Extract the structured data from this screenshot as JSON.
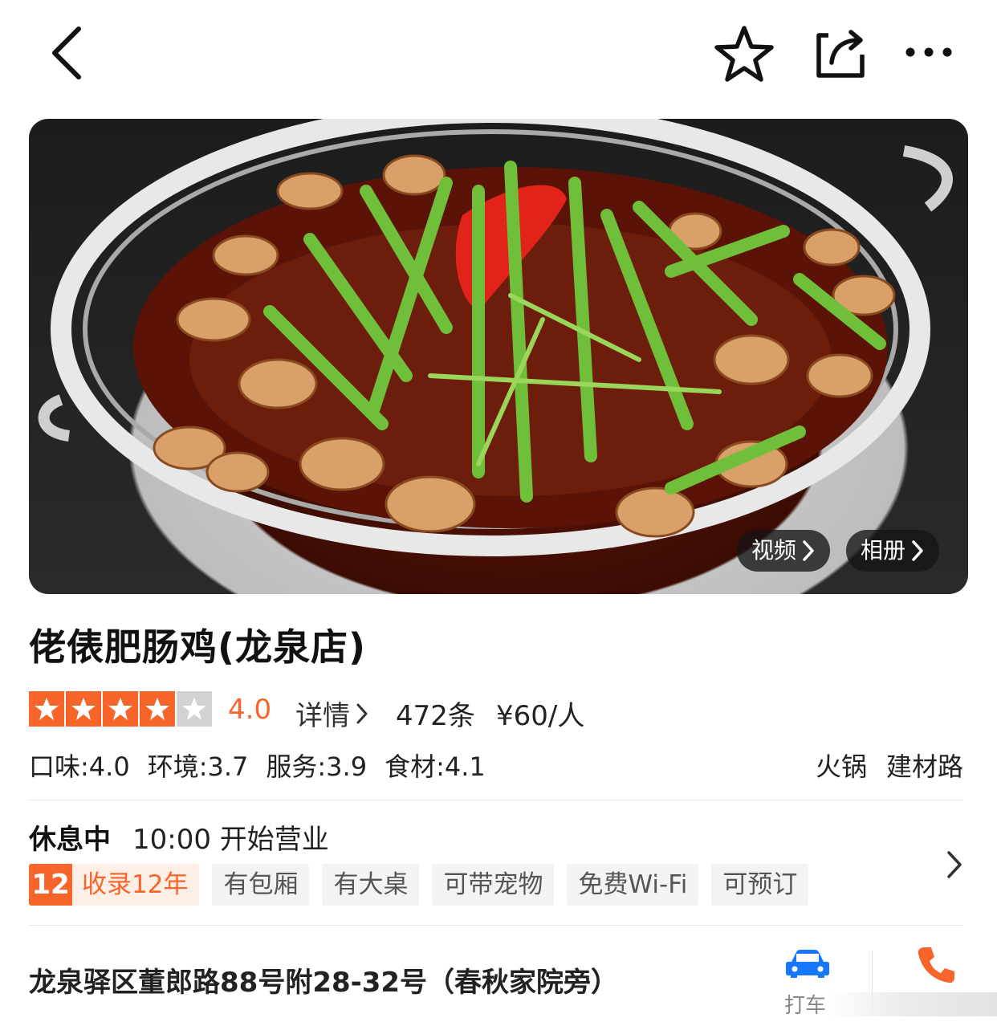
{
  "nav": {
    "back_icon": "chevron-left-icon",
    "favorite_icon": "star-outline-icon",
    "share_icon": "share-icon",
    "more_icon": "more-dots-icon"
  },
  "hero": {
    "video_label": "视频",
    "album_label": "相册"
  },
  "shop": {
    "name": "佬俵肥肠鸡(龙泉店)",
    "rating": {
      "value": 4.0,
      "max": 5,
      "text": "4.0"
    },
    "detail_label": "详情",
    "review_count": "472条",
    "price_per_person": "¥60/人",
    "scores": [
      {
        "label": "口味:4.0"
      },
      {
        "label": "环境:3.7"
      },
      {
        "label": "服务:3.9"
      },
      {
        "label": "食材:4.1"
      }
    ],
    "category": "火锅",
    "area": "建材路"
  },
  "hours": {
    "status": "休息中",
    "open_text": "10:00 开始营业"
  },
  "tags": {
    "years_badge": "12",
    "years_text": "收录12年",
    "items": [
      "有包厢",
      "有大桌",
      "可带宠物",
      "免费Wi-Fi",
      "可预订"
    ]
  },
  "address": {
    "text": "龙泉驿区董郎路88号附28-32号（春秋家院旁）",
    "taxi_label": "打车"
  },
  "colors": {
    "accent": "#f7652b",
    "taxi_blue": "#1677ff",
    "phone_orange": "#f7652b"
  }
}
